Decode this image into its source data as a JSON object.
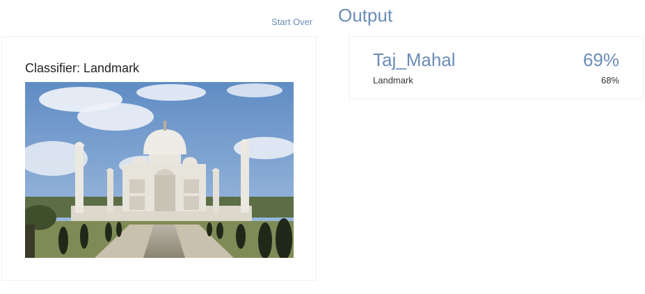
{
  "header": {
    "start_over_label": "Start Over",
    "output_title": "Output"
  },
  "input": {
    "classifier_label": "Classifier: Landmark"
  },
  "result": {
    "top_class": "Taj_Mahal",
    "top_score": "69%",
    "sub_class": "Landmark",
    "sub_score": "68%"
  },
  "colors": {
    "accent": "#6b8cb8",
    "sky": "#7da3d1",
    "marble": "#e8e6e0"
  }
}
